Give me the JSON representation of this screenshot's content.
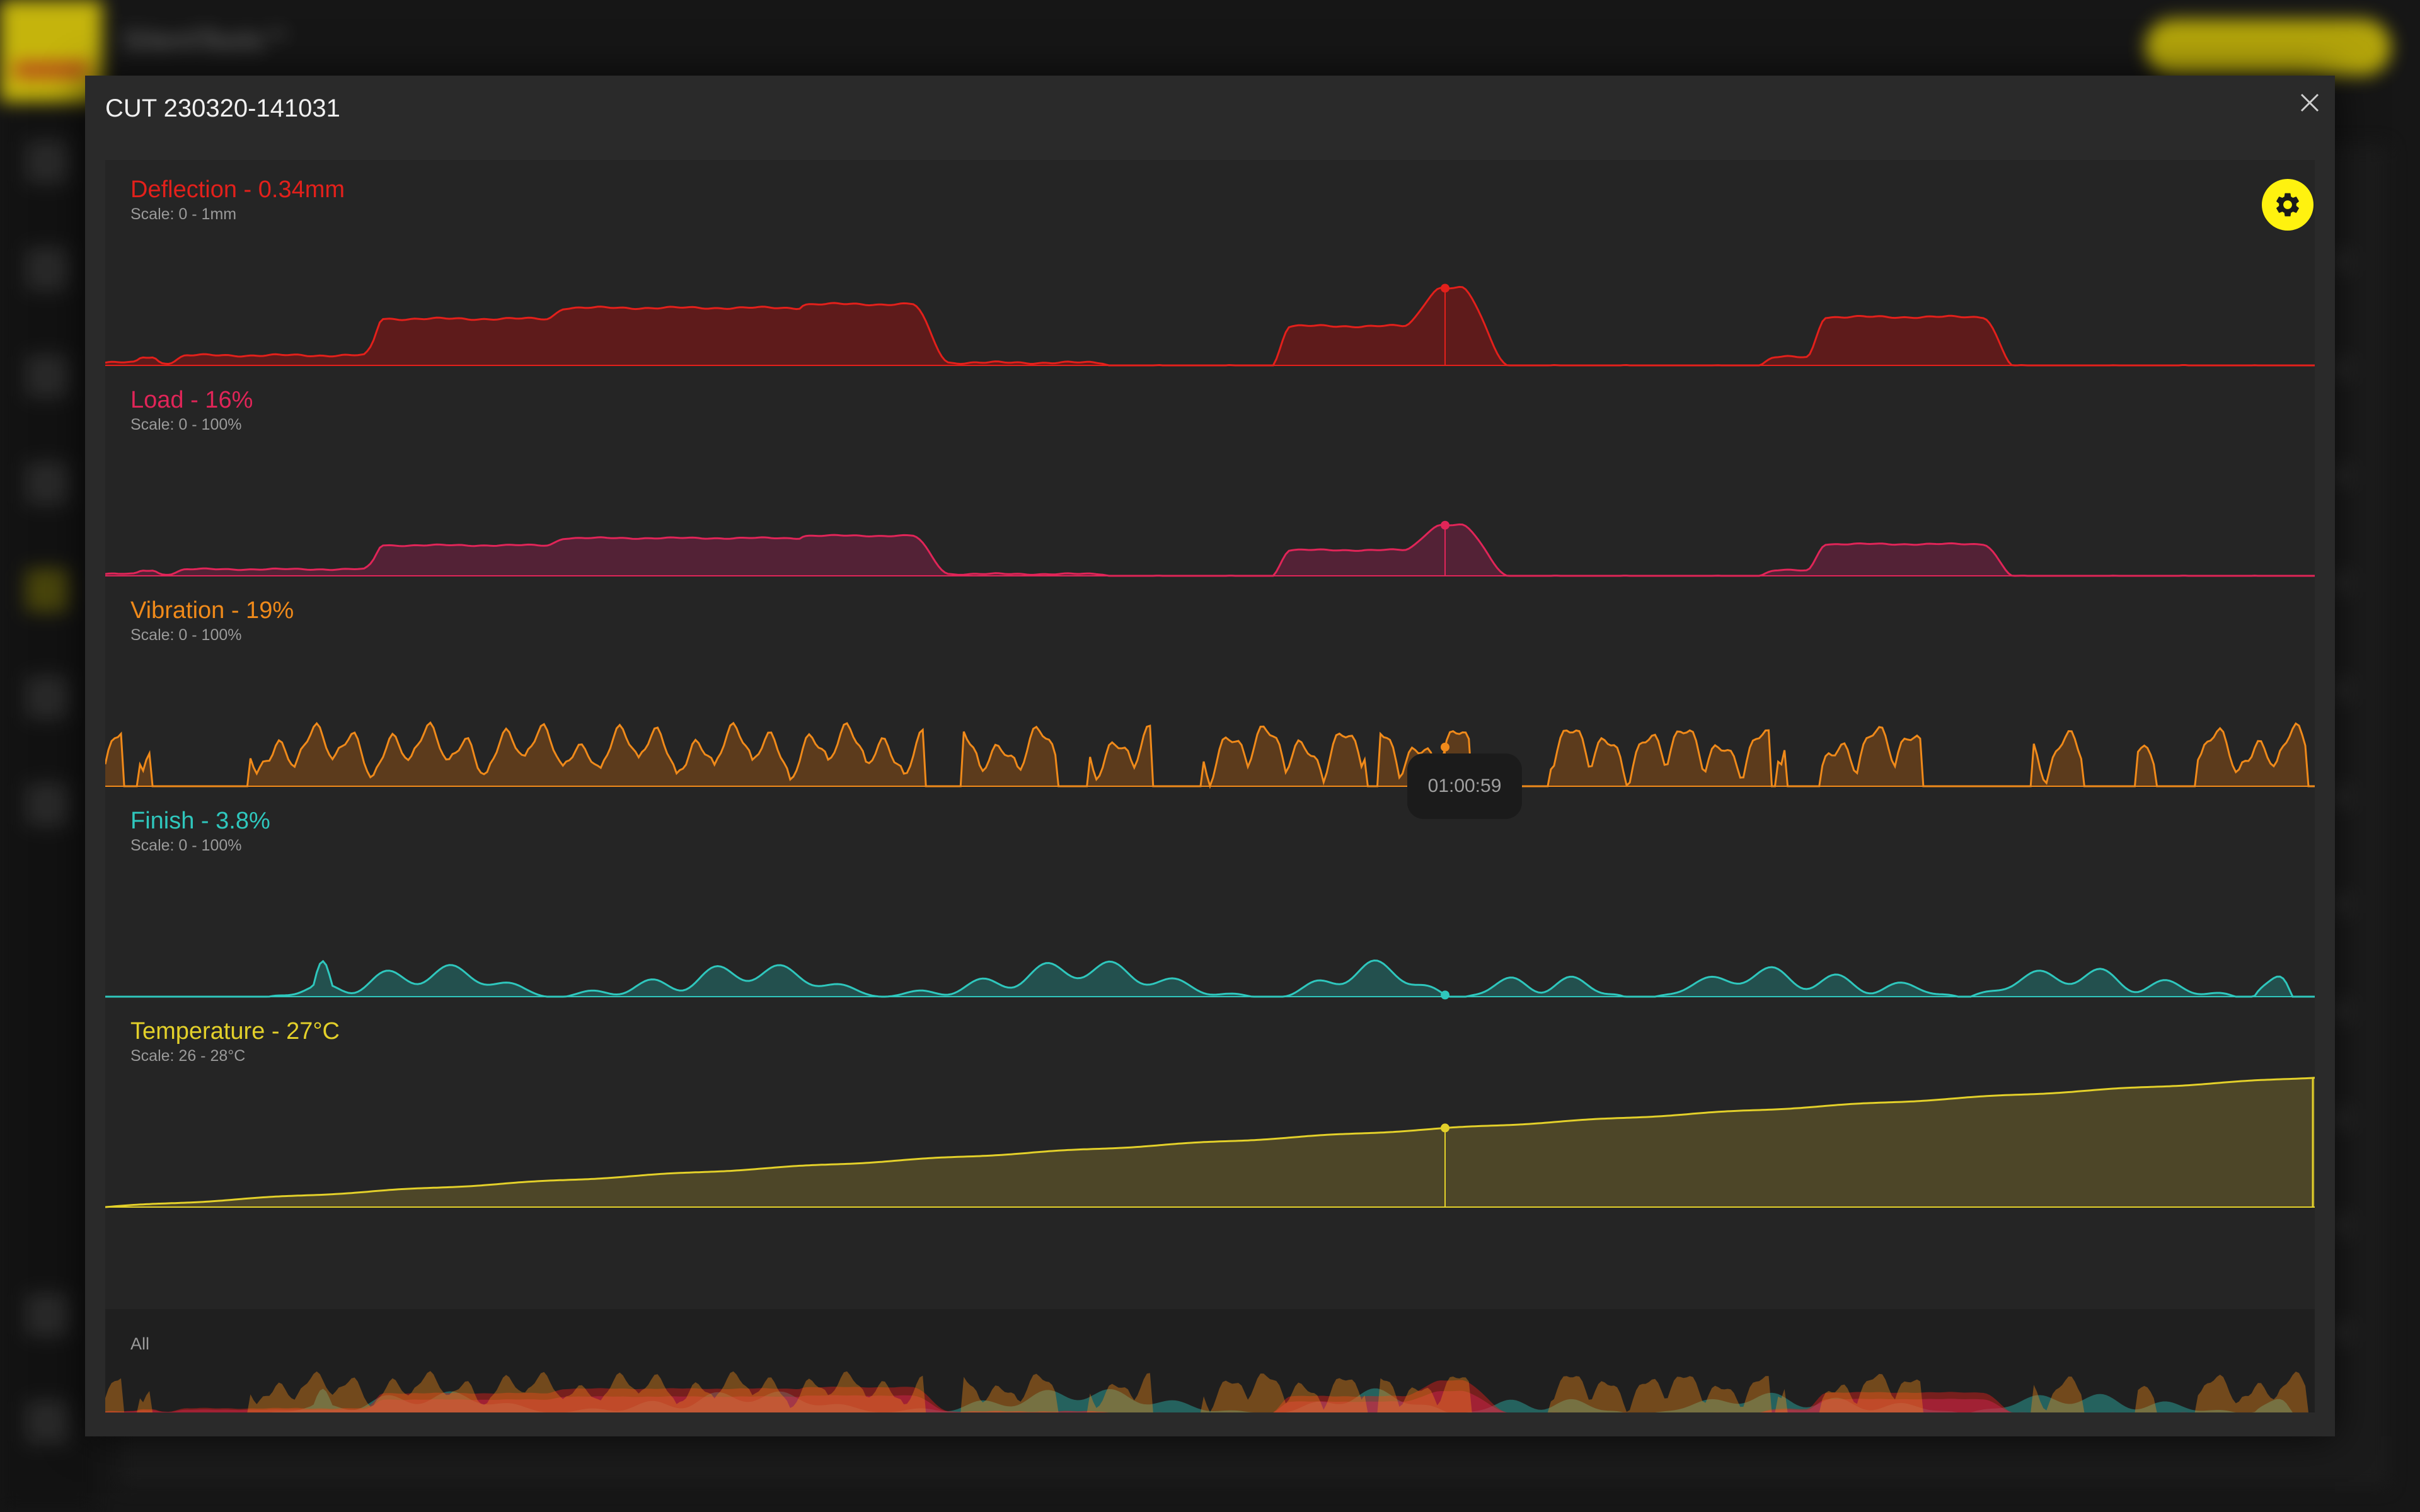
{
  "background_app": {
    "brand": "SilentTools™"
  },
  "modal": {
    "title": "CUT 230320-141031"
  },
  "tooltip": {
    "time": "01:00:59"
  },
  "panels": [
    {
      "key": "deflection",
      "title": "Deflection - 0.34mm",
      "scale": "Scale: 0 - 1mm",
      "color": "#e3201b",
      "fill": "#5e1b1b"
    },
    {
      "key": "load",
      "title": "Load - 16%",
      "scale": "Scale: 0 - 100%",
      "color": "#e02558",
      "fill": "#532236"
    },
    {
      "key": "vibration",
      "title": "Vibration - 19%",
      "scale": "Scale: 0 - 100%",
      "color": "#f08a1a",
      "fill": "#5c3b1c"
    },
    {
      "key": "finish",
      "title": "Finish - 3.8%",
      "scale": "Scale: 0 - 100%",
      "color": "#2fc7bd",
      "fill": "#23504e"
    },
    {
      "key": "temperature",
      "title": "Temperature - 27°C",
      "scale": "Scale: 26 - 28°C",
      "color": "#e3d02a",
      "fill": "#4d4628"
    }
  ],
  "all_panel": {
    "label": "All"
  },
  "icons": {
    "close": "close-icon",
    "settings": "gear-icon"
  }
}
